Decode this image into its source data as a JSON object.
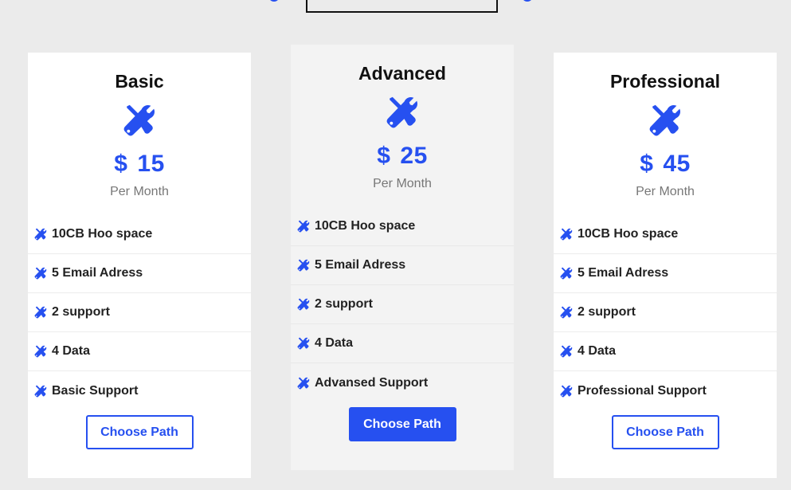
{
  "colors": {
    "accent": "#2650f0",
    "background": "#ebebeb",
    "card": "#ffffff",
    "featured_card": "#f3f3f3"
  },
  "plans": [
    {
      "title": "Basic",
      "currency": "$",
      "price": "15",
      "period": "Per Month",
      "features": [
        "10CB Hoo space",
        "5 Email Adress",
        "2 support",
        "4 Data",
        "Basic Support"
      ],
      "button": "Choose Path",
      "icon": "tools-icon"
    },
    {
      "title": "Advanced",
      "currency": "$",
      "price": "25",
      "period": "Per Month",
      "features": [
        "10CB Hoo space",
        "5 Email Adress",
        "2 support",
        "4 Data",
        "Advansed Support"
      ],
      "button": "Choose Path",
      "icon": "tools-icon"
    },
    {
      "title": "Professional",
      "currency": "$",
      "price": "45",
      "period": "Per Month",
      "features": [
        "10CB Hoo space",
        "5 Email Adress",
        "2 support",
        "4 Data",
        "Professional Support"
      ],
      "button": "Choose Path",
      "icon": "tools-icon"
    }
  ]
}
